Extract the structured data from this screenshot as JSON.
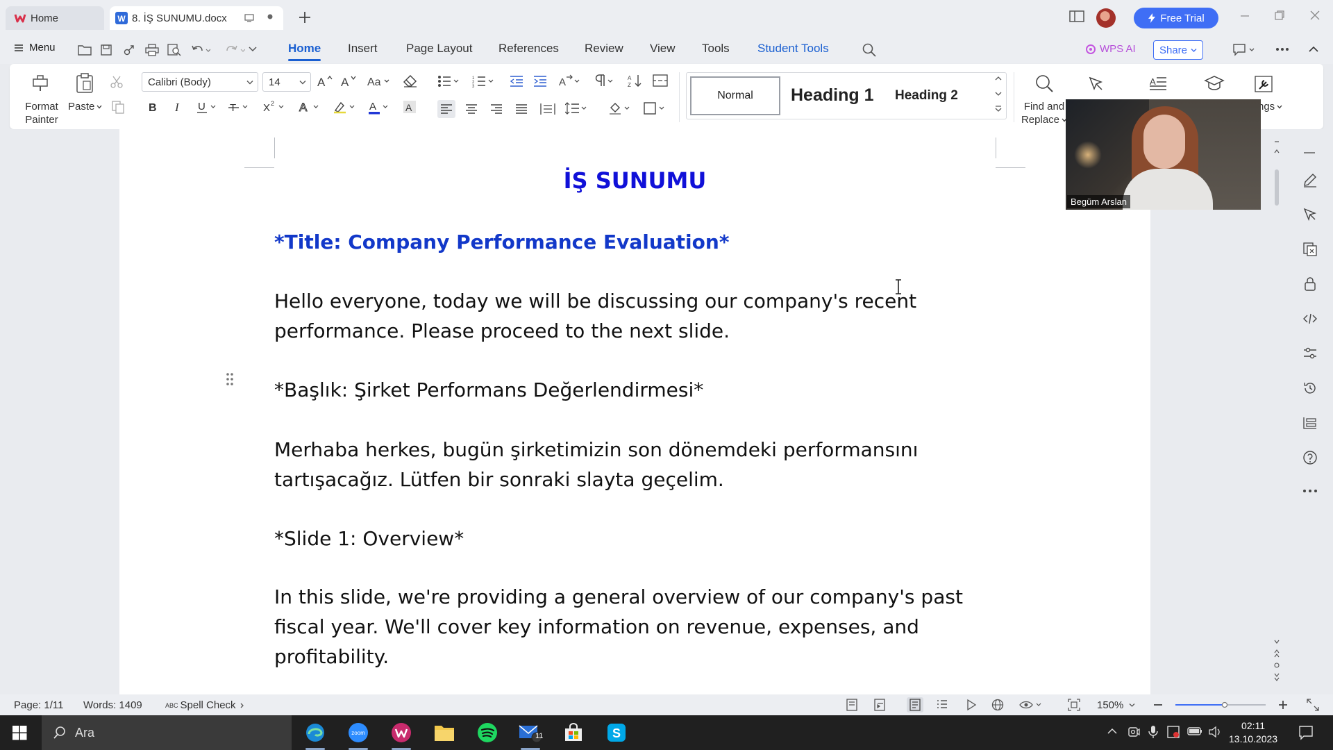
{
  "titlebar": {
    "tab_home": "Home",
    "tab_doc": "8. İŞ SUNUMU.docx",
    "free_trial": "Free Trial"
  },
  "menubar": {
    "menu": "Menu",
    "tabs": [
      "Home",
      "Insert",
      "Page Layout",
      "References",
      "Review",
      "View",
      "Tools",
      "Student Tools"
    ],
    "wps_ai": "WPS AI",
    "share": "Share"
  },
  "ribbon": {
    "format_painter": [
      "Format",
      "Painter"
    ],
    "paste": "Paste",
    "font_name": "Calibri (Body)",
    "font_size": "14",
    "styles": {
      "normal": "Normal",
      "heading1": "Heading 1",
      "heading2": "Heading 2"
    },
    "find_replace": [
      "Find and",
      "Replace"
    ],
    "settings_partial": "ngs"
  },
  "document": {
    "title": "İŞ SUNUMU",
    "paragraphs": [
      "*Title: Company Performance Evaluation*",
      "Hello everyone, today we will be discussing our company's recent performance. Please proceed to the next slide.",
      "*Başlık: Şirket Performans Değerlendirmesi*",
      "Merhaba herkes, bugün şirketimizin son dönemdeki performansını tartışacağız. Lütfen bir sonraki slayta geçelim.",
      "*Slide 1: Overview*",
      "In this slide, we're providing a general overview of our company's past fiscal year. We'll cover key information on revenue, expenses, and profitability."
    ]
  },
  "video": {
    "participant": "Begüm Arslan"
  },
  "statusbar": {
    "page": "Page: 1/11",
    "words": "Words: 1409",
    "spell_prefix": "ABC",
    "spell": "Spell Check",
    "zoom": "150%"
  },
  "taskbar": {
    "search": "Ara",
    "mail_badge": "11",
    "time": "02:11",
    "date": "13.10.2023"
  },
  "colors": {
    "accent": "#1a5fd1",
    "free_trial_bg": "#3f6ef5",
    "doc_title": "#1010d8",
    "doc_heading": "#1238c9"
  }
}
